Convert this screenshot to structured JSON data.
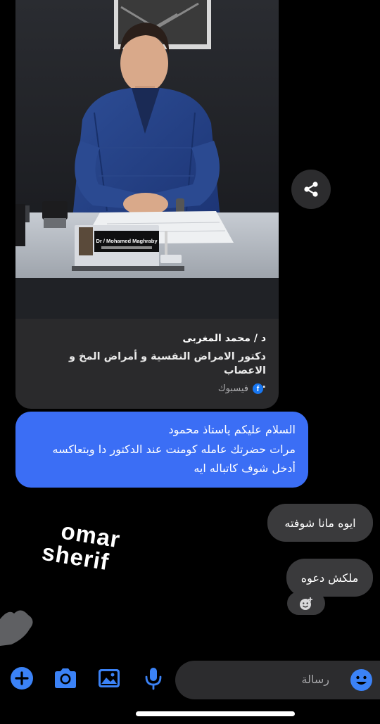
{
  "shared_post": {
    "nameplate": "Dr / Mohamed Maghraby",
    "title": "د / محمد المغربى",
    "description": "دكتور الامراض النفسية و أمراض المخ و الاعصاب",
    "ellipsis": "...",
    "source": "فيسبوك",
    "source_icon": "facebook-icon"
  },
  "messages": [
    {
      "direction": "outgoing",
      "lines": [
        "السلام عليكم ياستاذ محمود",
        "مرات حضرتك عامله كومنت عند الدكتور دا وبتعاكسه",
        "أدخل شوف كاتباله ايه"
      ]
    },
    {
      "direction": "incoming",
      "text": "ايوه مانا شوفته"
    },
    {
      "direction": "incoming",
      "text": "ملكش دعوه"
    }
  ],
  "watermark": {
    "line1": "omar",
    "line2": "sherif"
  },
  "composer": {
    "placeholder": "رسالة",
    "tools": [
      "plus-icon",
      "camera-icon",
      "gallery-icon",
      "microphone-icon"
    ],
    "emoji_icon": "emoji-icon"
  },
  "colors": {
    "outgoing_bubble": "#3b6ef5",
    "incoming_bubble": "#3a3a3c",
    "accent": "#3b82f6",
    "background": "#000000"
  }
}
